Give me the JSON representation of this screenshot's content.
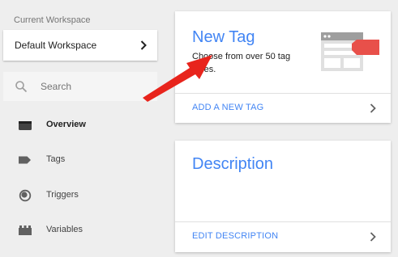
{
  "sidebar": {
    "workspace_label": "Current Workspace",
    "workspace_name": "Default Workspace",
    "search": {
      "placeholder": "Search"
    },
    "nav": [
      {
        "label": "Overview",
        "icon": "briefcase-icon",
        "active": true
      },
      {
        "label": "Tags",
        "icon": "tag-icon",
        "active": false
      },
      {
        "label": "Triggers",
        "icon": "trigger-icon",
        "active": false
      },
      {
        "label": "Variables",
        "icon": "variables-icon",
        "active": false
      }
    ]
  },
  "cards": {
    "new_tag": {
      "title": "New Tag",
      "description": "Choose from over 50 tag types.",
      "action": "ADD A NEW TAG"
    },
    "description": {
      "title": "Description",
      "action": "EDIT DESCRIPTION"
    }
  },
  "colors": {
    "accent": "#4285f4",
    "annotation": "#e8241c",
    "illustration_red": "#e8504a",
    "background": "#eeeeee"
  }
}
